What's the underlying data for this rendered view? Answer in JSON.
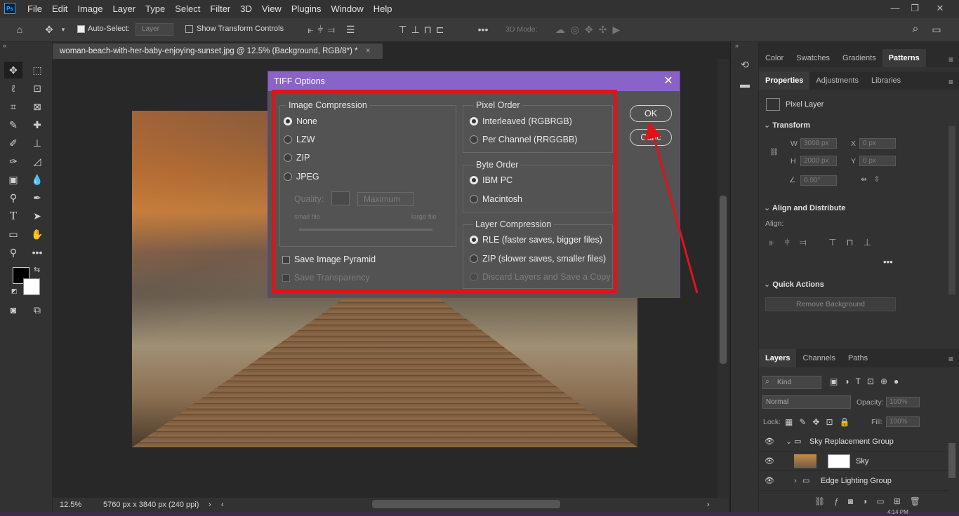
{
  "menubar": {
    "app_icon": "Ps",
    "items": [
      "File",
      "Edit",
      "Image",
      "Layer",
      "Type",
      "Select",
      "Filter",
      "3D",
      "View",
      "Plugins",
      "Window",
      "Help"
    ],
    "win_minimize": "—",
    "win_restore": "❐",
    "win_close": "✕"
  },
  "options": {
    "auto_select_label": "Auto-Select:",
    "auto_select_value": "Layer",
    "show_transform": "Show Transform Controls",
    "mode_3d": "3D Mode:"
  },
  "document": {
    "tab_title": "woman-beach-with-her-baby-enjoying-sunset.jpg @ 12.5% (Background, RGB/8*) *",
    "tab_close": "×",
    "zoom": "12.5%",
    "dimensions": "5760 px x 3840 px (240 ppi)"
  },
  "dialog": {
    "title": "TIFF Options",
    "close": "✕",
    "image_compression": {
      "title": "Image Compression",
      "options": [
        "None",
        "LZW",
        "ZIP",
        "JPEG"
      ],
      "selected": "None"
    },
    "quality_label": "Quality:",
    "quality_value": "Maximum",
    "small_file": "small file",
    "large_file": "large file",
    "save_pyramid": "Save Image Pyramid",
    "save_transparency": "Save Transparency",
    "pixel_order": {
      "title": "Pixel Order",
      "options": [
        "Interleaved (RGBRGB)",
        "Per Channel (RRGGBB)"
      ],
      "selected": "Interleaved (RGBRGB)"
    },
    "byte_order": {
      "title": "Byte Order",
      "options": [
        "IBM PC",
        "Macintosh"
      ],
      "selected": "IBM PC"
    },
    "layer_compression": {
      "title": "Layer Compression",
      "options": [
        "RLE (faster saves, bigger files)",
        "ZIP (slower saves, smaller files)",
        "Discard Layers and Save a Copy"
      ],
      "selected": "RLE (faster saves, bigger files)"
    },
    "ok": "OK",
    "cancel": "Canc"
  },
  "right_panel": {
    "top_tabs": [
      "Color",
      "Swatches",
      "Gradients",
      "Patterns"
    ],
    "prop_tabs": [
      "Properties",
      "Adjustments",
      "Libraries"
    ],
    "pixel_layer": "Pixel Layer",
    "transform": "Transform",
    "w_label": "W",
    "w_value": "3008 px",
    "x_label": "X",
    "x_value": "0 px",
    "h_label": "H",
    "h_value": "2000 px",
    "y_label": "Y",
    "y_value": "0 px",
    "angle_value": "0.00°",
    "align_distribute": "Align and Distribute",
    "align_label": "Align:",
    "quick_actions": "Quick Actions",
    "remove_bg": "Remove Background",
    "layer_tabs": [
      "Layers",
      "Channels",
      "Paths"
    ],
    "kind": "Kind",
    "blend": "Normal",
    "opacity_label": "Opacity:",
    "opacity_value": "100%",
    "lock_label": "Lock:",
    "fill_label": "Fill:",
    "fill_value": "100%",
    "layers": [
      "Sky Replacement Group",
      "Sky",
      "Edge Lighting Group"
    ],
    "time": "4:14 PM"
  }
}
